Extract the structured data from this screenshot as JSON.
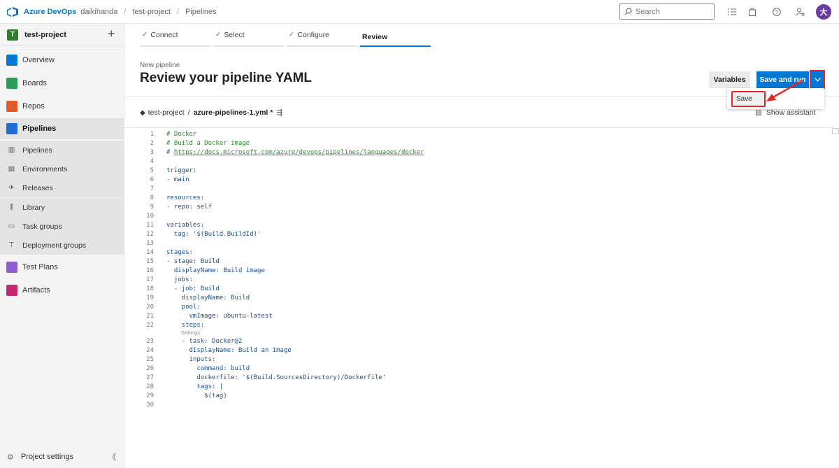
{
  "topbar": {
    "brand": "Azure DevOps",
    "org": "daikihanda",
    "separator": "/",
    "project": "test-project",
    "section": "Pipelines",
    "search_placeholder": "Search",
    "avatar_initial": "大"
  },
  "sidebar": {
    "project_badge": "T",
    "project_name": "test-project",
    "add_label": "+",
    "items": [
      {
        "label": "Overview",
        "color": "#0078d4"
      },
      {
        "label": "Boards",
        "color": "#2d9d5a"
      },
      {
        "label": "Repos",
        "color": "#e05a2b"
      },
      {
        "label": "Pipelines",
        "color": "#1e6fd9"
      },
      {
        "label": "Test Plans",
        "color": "#8b5fcf"
      },
      {
        "label": "Artifacts",
        "color": "#c3296c"
      }
    ],
    "sub_items": [
      {
        "label": "Pipelines",
        "icon": "pipelines-icon"
      },
      {
        "label": "Environments",
        "icon": "environments-icon"
      },
      {
        "label": "Releases",
        "icon": "releases-icon"
      },
      {
        "label": "Library",
        "icon": "library-icon"
      },
      {
        "label": "Task groups",
        "icon": "task-groups-icon"
      },
      {
        "label": "Deployment groups",
        "icon": "deployment-groups-icon"
      }
    ],
    "project_settings": "Project settings",
    "collapse_glyph": "《"
  },
  "wizard": {
    "steps": [
      {
        "label": "Connect",
        "done": true
      },
      {
        "label": "Select",
        "done": true
      },
      {
        "label": "Configure",
        "done": true
      },
      {
        "label": "Review",
        "done": false
      }
    ]
  },
  "header": {
    "subtitle": "New pipeline",
    "title": "Review your pipeline YAML",
    "variables_label": "Variables",
    "save_run_label": "Save and run"
  },
  "dropdown_menu": {
    "save_label": "Save"
  },
  "file": {
    "repo": "test-project",
    "sep": "/",
    "filename": "azure-pipelines-1.yml *",
    "show_assistant": "Show assistant"
  },
  "editor": {
    "lines": [
      {
        "n": "1",
        "text": "# Docker",
        "kind": "cmt"
      },
      {
        "n": "2",
        "text": "# Build a Docker image",
        "kind": "cmt"
      },
      {
        "n": "3",
        "text": "# https://docs.microsoft.com/azure/devops/pipelines/languages/docker",
        "kind": "url"
      },
      {
        "n": "4",
        "text": "",
        "kind": "code"
      },
      {
        "n": "5",
        "text": "trigger:",
        "kind": "code"
      },
      {
        "n": "6",
        "text": "- main",
        "kind": "code"
      },
      {
        "n": "7",
        "text": "",
        "kind": "code"
      },
      {
        "n": "8",
        "text": "resources:",
        "kind": "code"
      },
      {
        "n": "9",
        "text": "- repo: self",
        "kind": "code"
      },
      {
        "n": "10",
        "text": "",
        "kind": "code"
      },
      {
        "n": "11",
        "text": "variables:",
        "kind": "code"
      },
      {
        "n": "12",
        "text": "  tag: '$(Build.BuildId)'",
        "kind": "code"
      },
      {
        "n": "13",
        "text": "",
        "kind": "code"
      },
      {
        "n": "14",
        "text": "stages:",
        "kind": "code"
      },
      {
        "n": "15",
        "text": "- stage: Build",
        "kind": "code"
      },
      {
        "n": "16",
        "text": "  displayName: Build image",
        "kind": "code"
      },
      {
        "n": "17",
        "text": "  jobs:",
        "kind": "code"
      },
      {
        "n": "18",
        "text": "  - job: Build",
        "kind": "code"
      },
      {
        "n": "19",
        "text": "    displayName: Build",
        "kind": "code"
      },
      {
        "n": "20",
        "text": "    pool:",
        "kind": "code"
      },
      {
        "n": "21",
        "text": "      vmImage: ubuntu-latest",
        "kind": "code"
      },
      {
        "n": "22",
        "text": "    steps:",
        "kind": "code"
      },
      {
        "n": "23",
        "text": "    - task: Docker@2",
        "kind": "code"
      },
      {
        "n": "24",
        "text": "      displayName: Build an image",
        "kind": "code"
      },
      {
        "n": "25",
        "text": "      inputs:",
        "kind": "code"
      },
      {
        "n": "26",
        "text": "        command: build",
        "kind": "code"
      },
      {
        "n": "27",
        "text": "        dockerfile: '$(Build.SourcesDirectory)/Dockerfile'",
        "kind": "code"
      },
      {
        "n": "28",
        "text": "        tags: |",
        "kind": "code"
      },
      {
        "n": "29",
        "text": "          $(tag)",
        "kind": "code"
      },
      {
        "n": "30",
        "text": "",
        "kind": "code"
      }
    ],
    "settings_lens": "Settings"
  }
}
